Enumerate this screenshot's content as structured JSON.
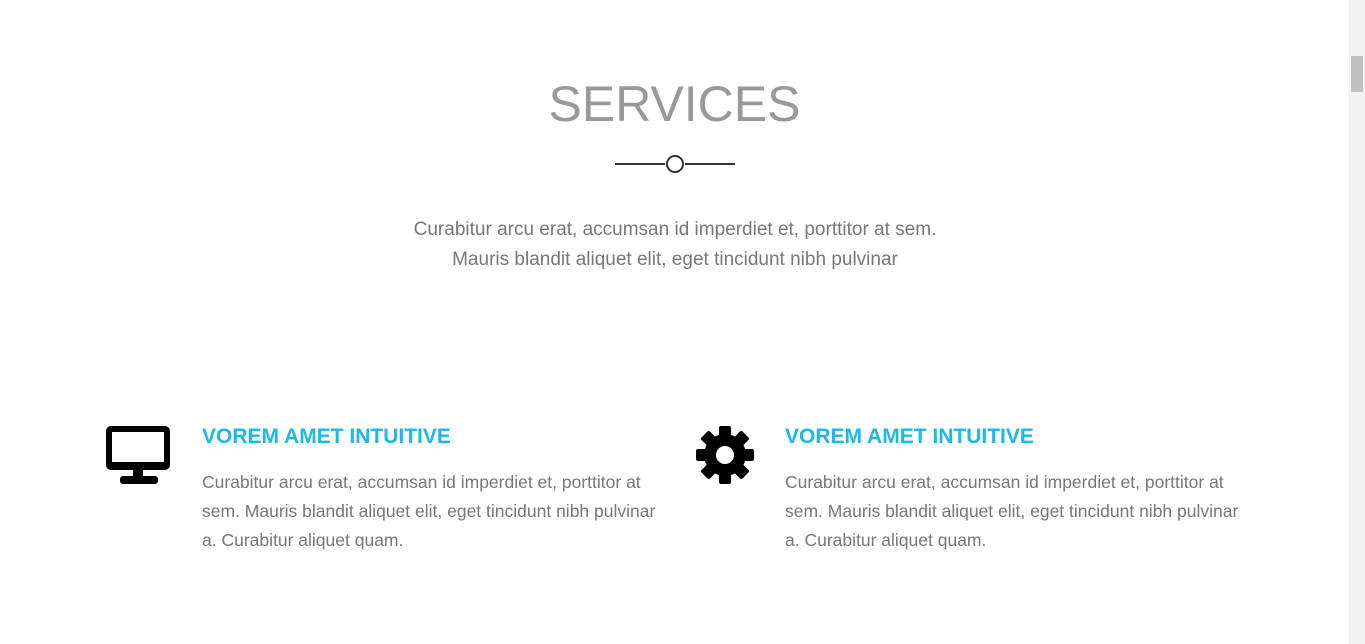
{
  "header": {
    "title": "SERVICES",
    "intro": "Curabitur arcu erat, accumsan id imperdiet et, porttitor at sem. Mauris blandit aliquet elit, eget tincidunt nibh pulvinar"
  },
  "services": [
    {
      "icon": "desktop-monitor-icon",
      "title": "VOREM AMET INTUITIVE",
      "text": "Curabitur arcu erat, accumsan id imperdiet et, porttitor at sem. Mauris blandit aliquet elit, eget tincidunt nibh pulvinar a. Curabitur aliquet quam."
    },
    {
      "icon": "gear-icon",
      "title": "VOREM AMET INTUITIVE",
      "text": "Curabitur arcu erat, accumsan id imperdiet et, porttitor at sem. Mauris blandit aliquet elit, eget tincidunt nibh pulvinar a. Curabitur aliquet quam."
    }
  ],
  "colors": {
    "accent": "#1cb8e8",
    "title": "#999999",
    "body_text": "#777777",
    "icon": "#000000"
  }
}
